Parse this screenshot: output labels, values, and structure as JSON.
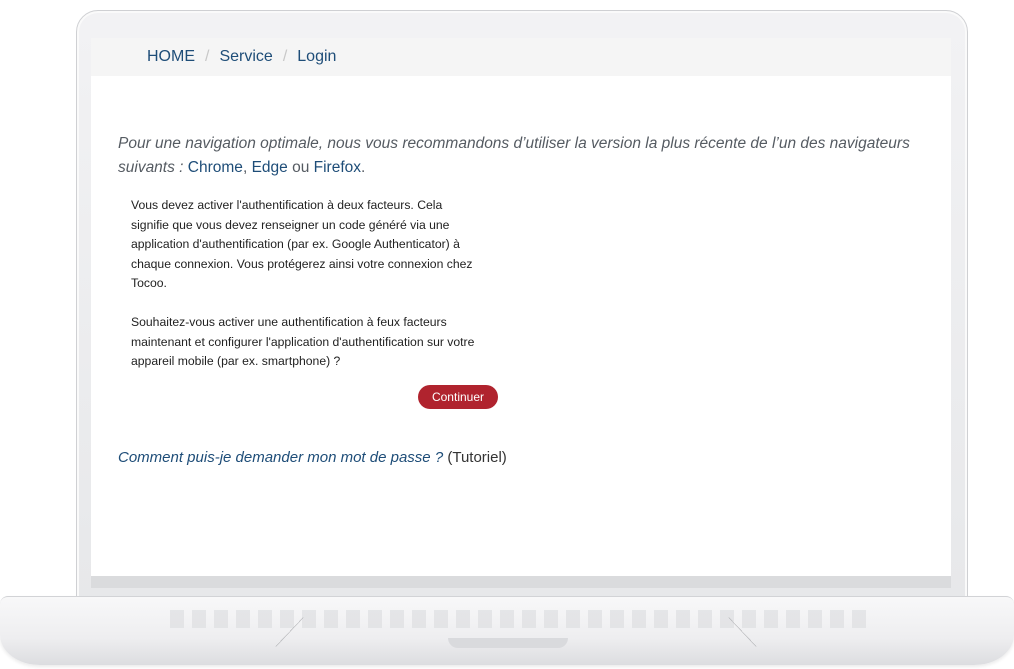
{
  "breadcrumb": {
    "items": [
      "HOME",
      "Service",
      "Login"
    ],
    "separator": "/"
  },
  "notice": {
    "intro": "Pour une navigation optimale, nous vous recommandons d’utiliser la version la plus récente de l’un des navigateurs suivants :",
    "browser_1": "Chrome",
    "comma": ",",
    "browser_2": "Edge",
    "conjunction": "ou",
    "browser_3": "Firefox",
    "period": "."
  },
  "twofa": {
    "paragraph_1": "Vous devez activer l'authentification à deux facteurs. Cela signifie que vous devez renseigner un code généré via une application d'authentification (par ex. Google Authenticator) à chaque connexion. Vous protégerez ainsi votre connexion chez Tocoo.",
    "paragraph_2": "Souhaitez-vous activer une authentification à feux facteurs maintenant et configurer l'application d'authentification sur votre appareil mobile (par ex. smartphone) ?",
    "continue_label": "Continuer"
  },
  "help": {
    "link_label": "Comment puis-je demander mon mot de passe ?",
    "suffix": "(Tutoriel)"
  },
  "colors": {
    "link": "#1e4d78",
    "button": "#b0232e",
    "breadcrumb_bg": "#f5f5f5"
  }
}
